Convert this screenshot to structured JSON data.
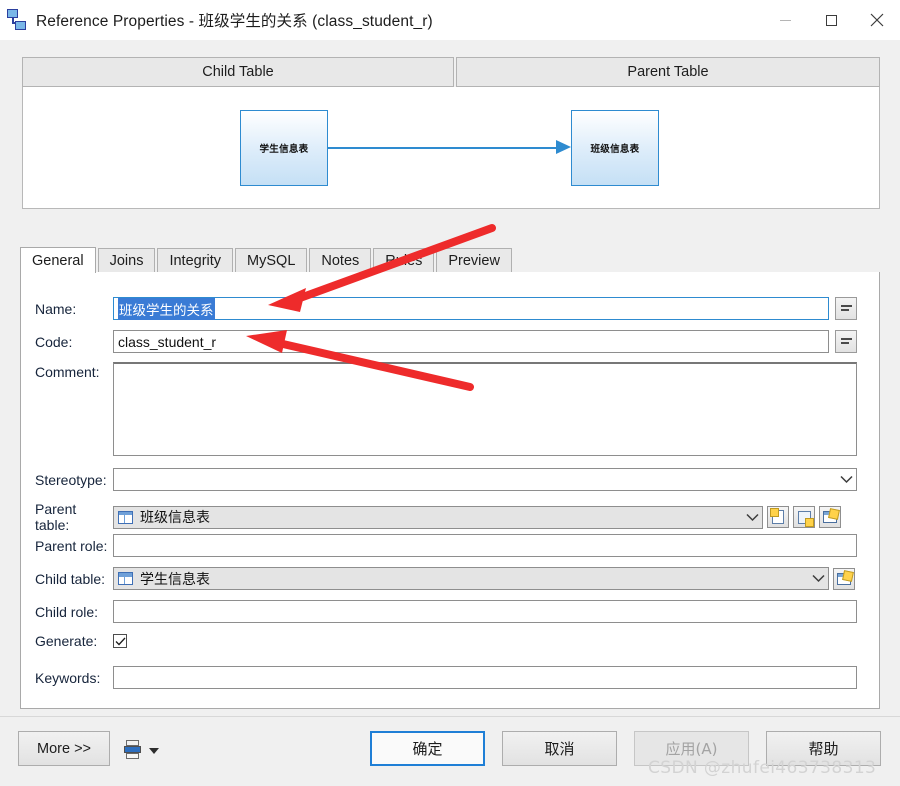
{
  "window": {
    "title": "Reference Properties - 班级学生的关系 (class_student_r)",
    "icon": "reference-link-icon",
    "minimize_label": "—",
    "maximize_label": "□",
    "close_label": "✕"
  },
  "preview": {
    "child_header": "Child Table",
    "parent_header": "Parent Table",
    "child_box_label": "学生信息表",
    "parent_box_label": "班级信息表",
    "relation_arrow": "right-arrow-icon"
  },
  "tabs": [
    {
      "label": "General",
      "active": true
    },
    {
      "label": "Joins",
      "active": false
    },
    {
      "label": "Integrity",
      "active": false
    },
    {
      "label": "MySQL",
      "active": false
    },
    {
      "label": "Notes",
      "active": false
    },
    {
      "label": "Rules",
      "active": false
    },
    {
      "label": "Preview",
      "active": false
    }
  ],
  "form": {
    "name": {
      "label": "Name:",
      "value": "班级学生的关系",
      "selected": true,
      "focused": true,
      "side_button": "equals-button"
    },
    "code": {
      "label": "Code:",
      "value": "class_student_r",
      "side_button": "equals-button"
    },
    "comment": {
      "label": "Comment:",
      "value": ""
    },
    "stereotype": {
      "label": "Stereotype:",
      "value": "",
      "dropdown": "chevron-down-icon"
    },
    "parent_table": {
      "label": "Parent table:",
      "value": "班级信息表",
      "icon": "table-icon",
      "dropdown": "chevron-down-icon",
      "buttons": [
        "new-document-icon",
        "browse-magnifier-icon",
        "properties-icon"
      ]
    },
    "parent_role": {
      "label": "Parent role:",
      "value": ""
    },
    "child_table": {
      "label": "Child table:",
      "value": "学生信息表",
      "icon": "table-icon",
      "dropdown": "chevron-down-icon",
      "buttons": [
        "properties-icon"
      ]
    },
    "child_role": {
      "label": "Child role:",
      "value": ""
    },
    "generate": {
      "label": "Generate:",
      "checked": true
    },
    "keywords": {
      "label": "Keywords:",
      "value": ""
    }
  },
  "footer": {
    "more_label": "More >>",
    "print_icon": "print-icon",
    "print_caret": "caret-down-icon",
    "ok_label": "确定",
    "cancel_label": "取消",
    "apply_label": "应用(A)",
    "apply_disabled": true,
    "help_label": "帮助"
  },
  "watermark": {
    "text": "CSDN @zhufei463738313"
  },
  "annotations": {
    "accent_color": "#ee2b2b",
    "arrow_1": "red-arrow-to-name-field",
    "arrow_2": "red-arrow-to-code-field"
  }
}
